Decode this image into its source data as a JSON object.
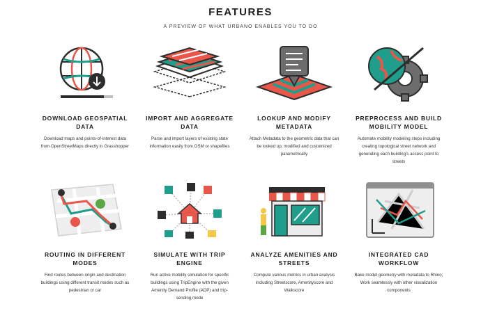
{
  "header": {
    "title": "FEATURES",
    "subtitle": "A PREVIEW OF WHAT URBANO ENABLES YOU TO DO"
  },
  "colors": {
    "coral": "#e8574a",
    "teal": "#1f9e8c",
    "dark": "#2d2d2d",
    "gray": "#8f8f8f",
    "green": "#5aa544",
    "yellow": "#f2c84b"
  },
  "features": [
    {
      "icon": "globe-download-icon",
      "title": "DOWNLOAD GEOSPATIAL DATA",
      "description": "Download maps and points-of-interest data from OpenStreetMaps directly in Grasshopper"
    },
    {
      "icon": "layers-icon",
      "title": "IMPORT AND AGGREGATE DATA",
      "description": "Parse and import layers of existing state information easily from OSM or shapefiles"
    },
    {
      "icon": "map-pin-metadata-icon",
      "title": "LOOKUP AND MODIFY METADATA",
      "description": "Attach Metadata to the geometric data that can be looked up, modified and customized parametrically"
    },
    {
      "icon": "globe-gear-icon",
      "title": "PREPROCESS AND BUILD MOBILITY MODEL",
      "description": "Automate mobility modeling steps including creating topological street network and generating each building's access point to streets"
    },
    {
      "icon": "route-map-icon",
      "title": "ROUTING IN DIFFERENT MODES",
      "description": "Find routes between origin and destination buildings using different transit modes such as pedestrian or car"
    },
    {
      "icon": "trip-network-icon",
      "title": "SIMULATE WITH TRIP ENGINE",
      "description": "Run active mobility simulation for specific buildings using TripEngine with the given Amenity Demand Profile (ADP) and trip-sending mode"
    },
    {
      "icon": "storefront-icon",
      "title": "ANALYZE AMENITIES AND STREETS",
      "description": "Compute various metrics in urban analysis including Streetscore, Amenityscore and Walkscore"
    },
    {
      "icon": "cad-window-icon",
      "title": "INTEGRATED CAD WORKFLOW",
      "description": "Bake model geometry with metadata to Rhino; Work seamlessly with other visualization components"
    }
  ]
}
